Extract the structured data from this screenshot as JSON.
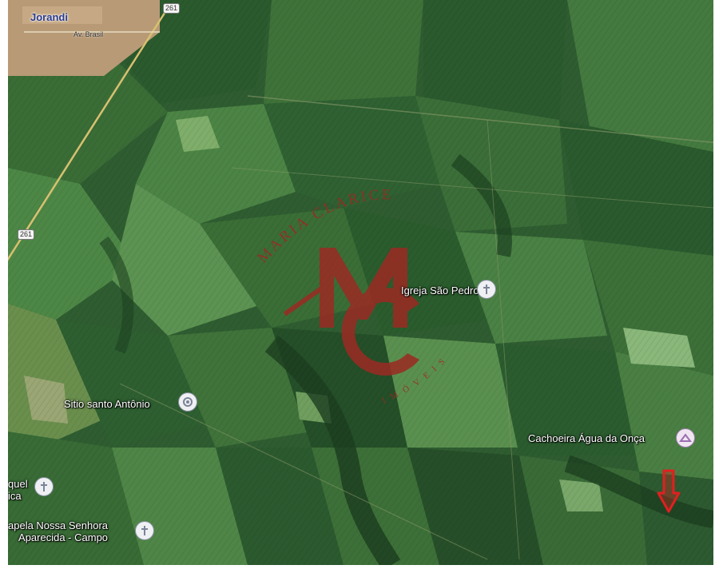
{
  "map": {
    "town_label": "Jorandi",
    "street_label": "Av. Brasil",
    "road_shields": [
      "261",
      "261"
    ],
    "places": [
      {
        "name": "Igreja São Pedro",
        "icon": "church-pin-icon"
      },
      {
        "name": "Sitio santo Antônio",
        "icon": "place-pin-icon"
      },
      {
        "name": "Cachoeira Água da Onça",
        "icon": "waterfall-pin-icon"
      },
      {
        "name": "quel\nica",
        "icon": "church-pin-icon"
      },
      {
        "name": "apela Nossa Senhora\nAparecida - Campo",
        "icon": "church-pin-icon"
      }
    ],
    "marker": {
      "icon": "red-down-arrow-icon",
      "color": "#e02020"
    }
  },
  "watermark": {
    "brand_top": "MARIA CLARICE",
    "monogram": "MC",
    "brand_bottom": "IMÓVEIS",
    "color": "#9b2a23"
  },
  "colors": {
    "field_dark": "#24502a",
    "field_mid": "#3b6f37",
    "field_light": "#5f9453",
    "town_area": "#b89a76",
    "road": "#d8c071"
  }
}
